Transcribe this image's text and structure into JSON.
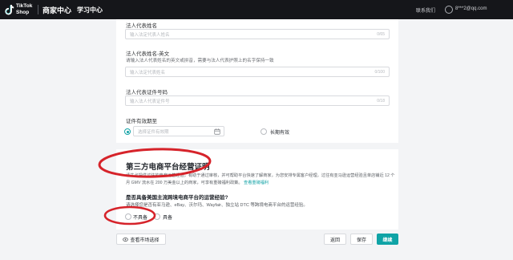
{
  "header": {
    "logo_line1": "TikTok",
    "logo_line2": "Shop",
    "nav_seller_center": "商家中心",
    "nav_learning_center": "学习中心",
    "contact_us": "联系我们",
    "user_email": "8***2@qq.com"
  },
  "form": {
    "legal_rep_name": {
      "label": "法人代表姓名",
      "placeholder": "输入法定代表人姓名",
      "counter": "0/65"
    },
    "legal_rep_name_en": {
      "label": "法人代表姓名-英文",
      "hint": "请输入法人代表姓名的英文或拼音，需要与法人代表护照上的名字保持一致",
      "placeholder": "输入法定代表姓名",
      "counter": "0/100"
    },
    "legal_rep_id": {
      "label": "法人代表证件号码",
      "placeholder": "输入法人代表证件号",
      "counter": "0/18"
    },
    "id_validity": {
      "label": "证件有效期至",
      "date_placeholder": "选择证件有效期",
      "long_term_label": "长期有效",
      "selected": "date"
    }
  },
  "third_party": {
    "title": "第三方电商平台经营证明",
    "desc_line1": "请共必提供过往的电商运营经验，有助于通过审核，并可帮助平台快速了解商家，为您安排专属客户经理，过往有亚马逊运营经验且单店铺近 12 个",
    "desc_line2": "月 GMV 流水在 200 万美金以上的商家，可享有重磅福利政策。",
    "desc_link": "查看重磅福利",
    "question": "是否具备美国主流跨境电商平台的运营经验?",
    "question_hint": "请选择您是否有亚马逊、eBay、沃尔玛、Wayfair、独立站 DTC 等跨境电商平台的运营经验。",
    "option_no": "不具备",
    "option_yes": "具备"
  },
  "footer": {
    "view_market_label": "查看市场选择",
    "back_label": "返回",
    "save_label": "保存",
    "continue_label": "继续"
  },
  "colors": {
    "accent": "#0fa3a6",
    "annotation": "#d6232a",
    "topbar": "#15161a"
  }
}
